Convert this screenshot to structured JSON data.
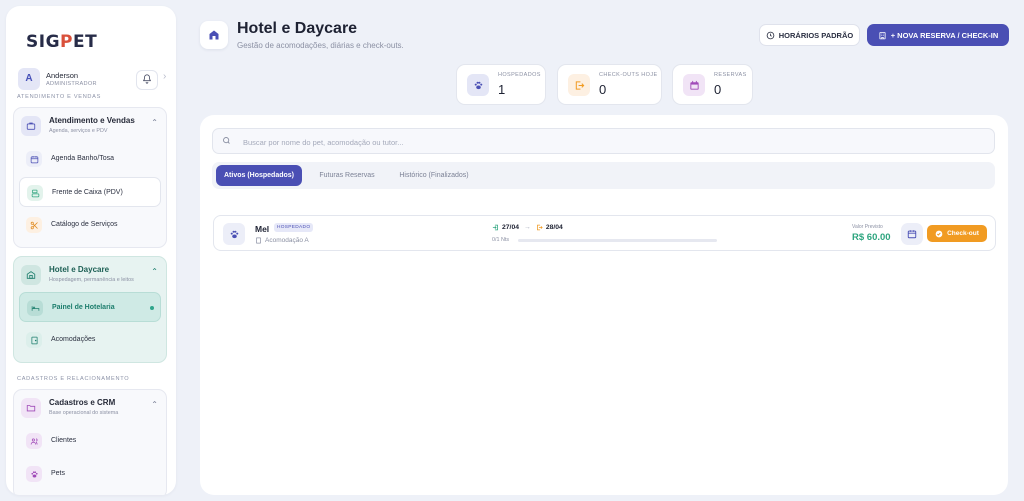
{
  "brand": {
    "logo_prefix": "SIG",
    "logo_accent": "P",
    "logo_suffix": "ET",
    "accent_color": "#d9503b",
    "primary_color": "#4a4fb4"
  },
  "user": {
    "initial": "A",
    "name": "Anderson",
    "role": "ADMINISTRADOR"
  },
  "sidebar": {
    "section_sales": "ATENDIMENTO E VENDAS",
    "group_sales": {
      "title": "Atendimento e Vendas",
      "subtitle": "Agenda, serviços e PDV",
      "items": [
        {
          "label": "Agenda Banho/Tosa",
          "icon": "calendar-icon"
        },
        {
          "label": "Frente de Caixa (PDV)",
          "icon": "cash-register-icon"
        },
        {
          "label": "Catálogo de Serviços",
          "icon": "scissors-icon"
        }
      ]
    },
    "group_hotel": {
      "title": "Hotel e Daycare",
      "subtitle": "Hospedagem, permanência e leitos",
      "items": [
        {
          "label": "Painel de Hotelaria",
          "icon": "bed-icon"
        },
        {
          "label": "Acomodações",
          "icon": "door-icon"
        }
      ]
    },
    "section_crm": "CADASTROS E RELACIONAMENTO",
    "group_crm": {
      "title": "Cadastros e CRM",
      "subtitle": "Base operacional do sistema",
      "items": [
        {
          "label": "Clientes",
          "icon": "users-icon"
        },
        {
          "label": "Pets",
          "icon": "paw-icon"
        }
      ]
    }
  },
  "header": {
    "title": "Hotel e Daycare",
    "subtitle": "Gestão de acomodações, diárias e check-outs.",
    "schedule_button": "HORÁRIOS PADRÃO",
    "new_booking_button": "+ NOVA RESERVA / CHECK-IN"
  },
  "stats": [
    {
      "label": "HOSPEDADOS",
      "value": "1",
      "icon": "paw-icon",
      "color": "#4a4fb4"
    },
    {
      "label": "CHECK-OUTS HOJE",
      "value": "0",
      "icon": "logout-icon",
      "color": "#f19b22"
    },
    {
      "label": "RESERVAS",
      "value": "0",
      "icon": "calendar-icon",
      "color": "#a04ab8"
    }
  ],
  "search": {
    "placeholder": "Buscar por nome do pet, acomodação ou tutor..."
  },
  "tabs": [
    {
      "label": "Ativos (Hospedados)",
      "active": true
    },
    {
      "label": "Futuras Reservas",
      "active": false
    },
    {
      "label": "Histórico (Finalizados)",
      "active": false
    }
  ],
  "bookings": [
    {
      "pet": "Mel",
      "status": "HOSPEDADO",
      "room": "Acomodação A",
      "checkin": "27/04",
      "checkout": "28/04",
      "nights_label": "0/1 Nts",
      "progress": 0,
      "value_label": "Valor Previsto",
      "value": "R$ 60.00",
      "checkout_button": "Check-out",
      "value_color": "#2ea57f"
    }
  ]
}
